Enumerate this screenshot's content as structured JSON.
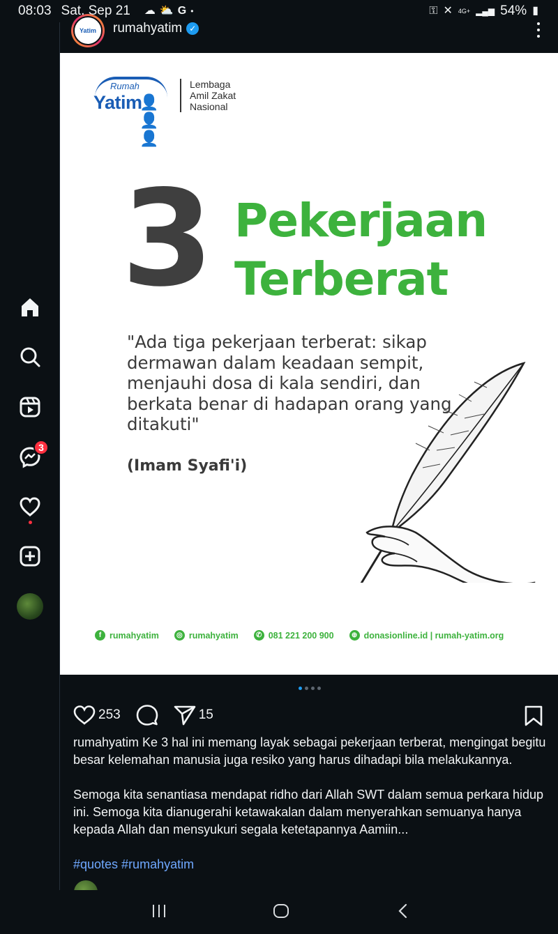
{
  "status_bar": {
    "time": "08:03",
    "date": "Sat, Sep 21",
    "network": "4G+",
    "battery": "54%"
  },
  "rail": {
    "messages_badge": "3"
  },
  "post": {
    "username": "rumahyatim",
    "avatar_text": "Yatim",
    "image": {
      "logo_rumah": "Rumah",
      "logo_yatim": "Yatim",
      "logo_org_line1": "Lembaga",
      "logo_org_line2": "Amil Zakat",
      "logo_org_line3": "Nasional",
      "number": "3",
      "title_line1": "Pekerjaan",
      "title_line2": "Terberat",
      "quote": "\"Ada tiga pekerjaan terberat: sikap dermawan dalam keadaan sempit, menjauhi dosa di kala sendiri, dan berkata benar di hadapan orang yang ditakuti\"",
      "author": "(Imam Syafi'i)",
      "footer": {
        "facebook": "rumahyatim",
        "instagram": "rumahyatim",
        "whatsapp": "081 221 200 900",
        "web": "donasionline.id | rumah-yatim.org"
      }
    },
    "likes": "253",
    "shares": "15",
    "caption_username": "rumahyatim",
    "caption_p1": "Ke 3 hal ini memang layak sebagai pekerjaan terberat, mengingat begitu besar kelemahan manusia juga resiko yang harus dihadapi bila melakukannya.",
    "caption_p2": "Semoga kita senantiasa mendapat ridho dari Allah SWT dalam semua perkara hidup ini. Semoga kita dianugerahi ketawakalan dalam menyerahkan semuanya hanya kepada Allah dan mensyukuri segala ketetapannya Aamiin...",
    "hashtags": "#quotes #rumahyatim",
    "carousel_pages": 4,
    "carousel_index": 1
  },
  "colors": {
    "background": "#0b1014",
    "accent_green": "#3db23d",
    "badge_red": "#ff3040",
    "verified_blue": "#1d9bf0",
    "hashtag_blue": "#6fa8ff"
  }
}
